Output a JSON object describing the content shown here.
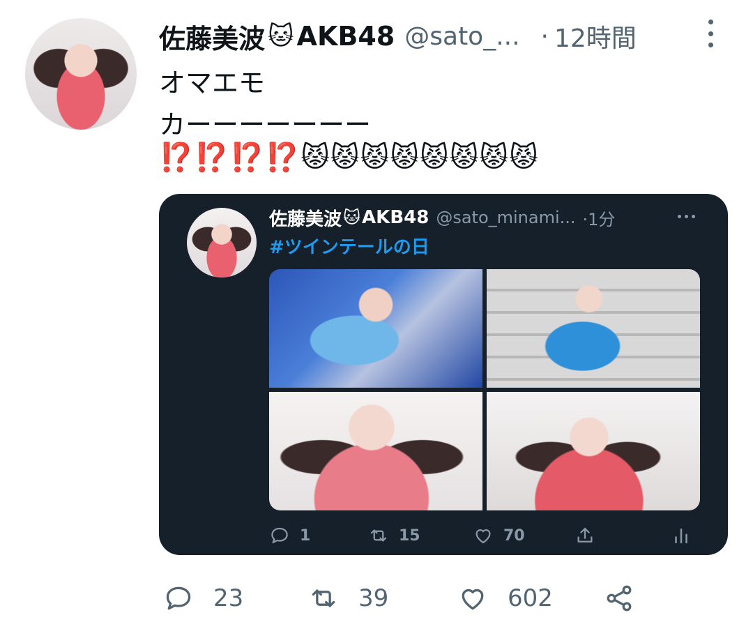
{
  "tweet": {
    "author_name": "佐藤美波",
    "author_emoji": "🐱",
    "author_suffix": "AKB48",
    "handle": "@sato_...",
    "separator": "·",
    "time": "12時間",
    "text_line1": "オマエモ",
    "text_line2": "カーーーーーーー",
    "text_line3_marks": "⁉️⁉️⁉️⁉️",
    "text_line3_emojis": "😾😾😾😾😾😾😾😾"
  },
  "quoted": {
    "author_name": "佐藤美波",
    "author_emoji": "🐱",
    "author_suffix": "AKB48",
    "handle": "@sato_minami...",
    "time": "·1分",
    "hashtag": "#ツインテールの日",
    "reply_count": "1",
    "retweet_count": "15",
    "like_count": "70"
  },
  "actions": {
    "reply_count": "23",
    "retweet_count": "39",
    "like_count": "602"
  },
  "colors": {
    "accent": "#1d9bf0",
    "quote_bg": "#15202b",
    "secondary_text": "#536471"
  }
}
